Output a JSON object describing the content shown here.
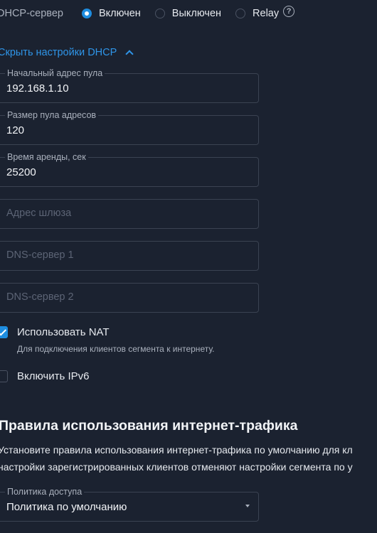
{
  "dhcp": {
    "label": "DHCP-сервер",
    "options": [
      "Включен",
      "Выключен",
      "Relay"
    ],
    "selected": "Включен"
  },
  "settings_toggle": "Скрыть настройки DHCP",
  "fields": {
    "pool_start": {
      "label": "Начальный адрес пула",
      "value": "192.168.1.10"
    },
    "pool_size": {
      "label": "Размер пула адресов",
      "value": "120"
    },
    "lease_time": {
      "label": "Время аренды, сек",
      "value": "25200"
    },
    "gateway": {
      "placeholder": "Адрес шлюза"
    },
    "dns1": {
      "placeholder": "DNS-сервер 1"
    },
    "dns2": {
      "placeholder": "DNS-сервер 2"
    }
  },
  "nat": {
    "label": "Использовать NAT",
    "checked": true,
    "hint": "Для подключения клиентов сегмента к интернету."
  },
  "ipv6": {
    "label": "Включить IPv6",
    "checked": false
  },
  "rules": {
    "title": "Правила использования интернет-трафика",
    "line1": "Установите правила использования интернет-трафика по умолчанию для кл",
    "line2": "настройки зарегистрированных клиентов отменяют настройки сегмента по у"
  },
  "policy": {
    "label": "Политика доступа",
    "value": "Политика по умолчанию"
  },
  "colors": {
    "background": "#1b2230",
    "accent": "#1e8de0",
    "link": "#2f95e8"
  }
}
